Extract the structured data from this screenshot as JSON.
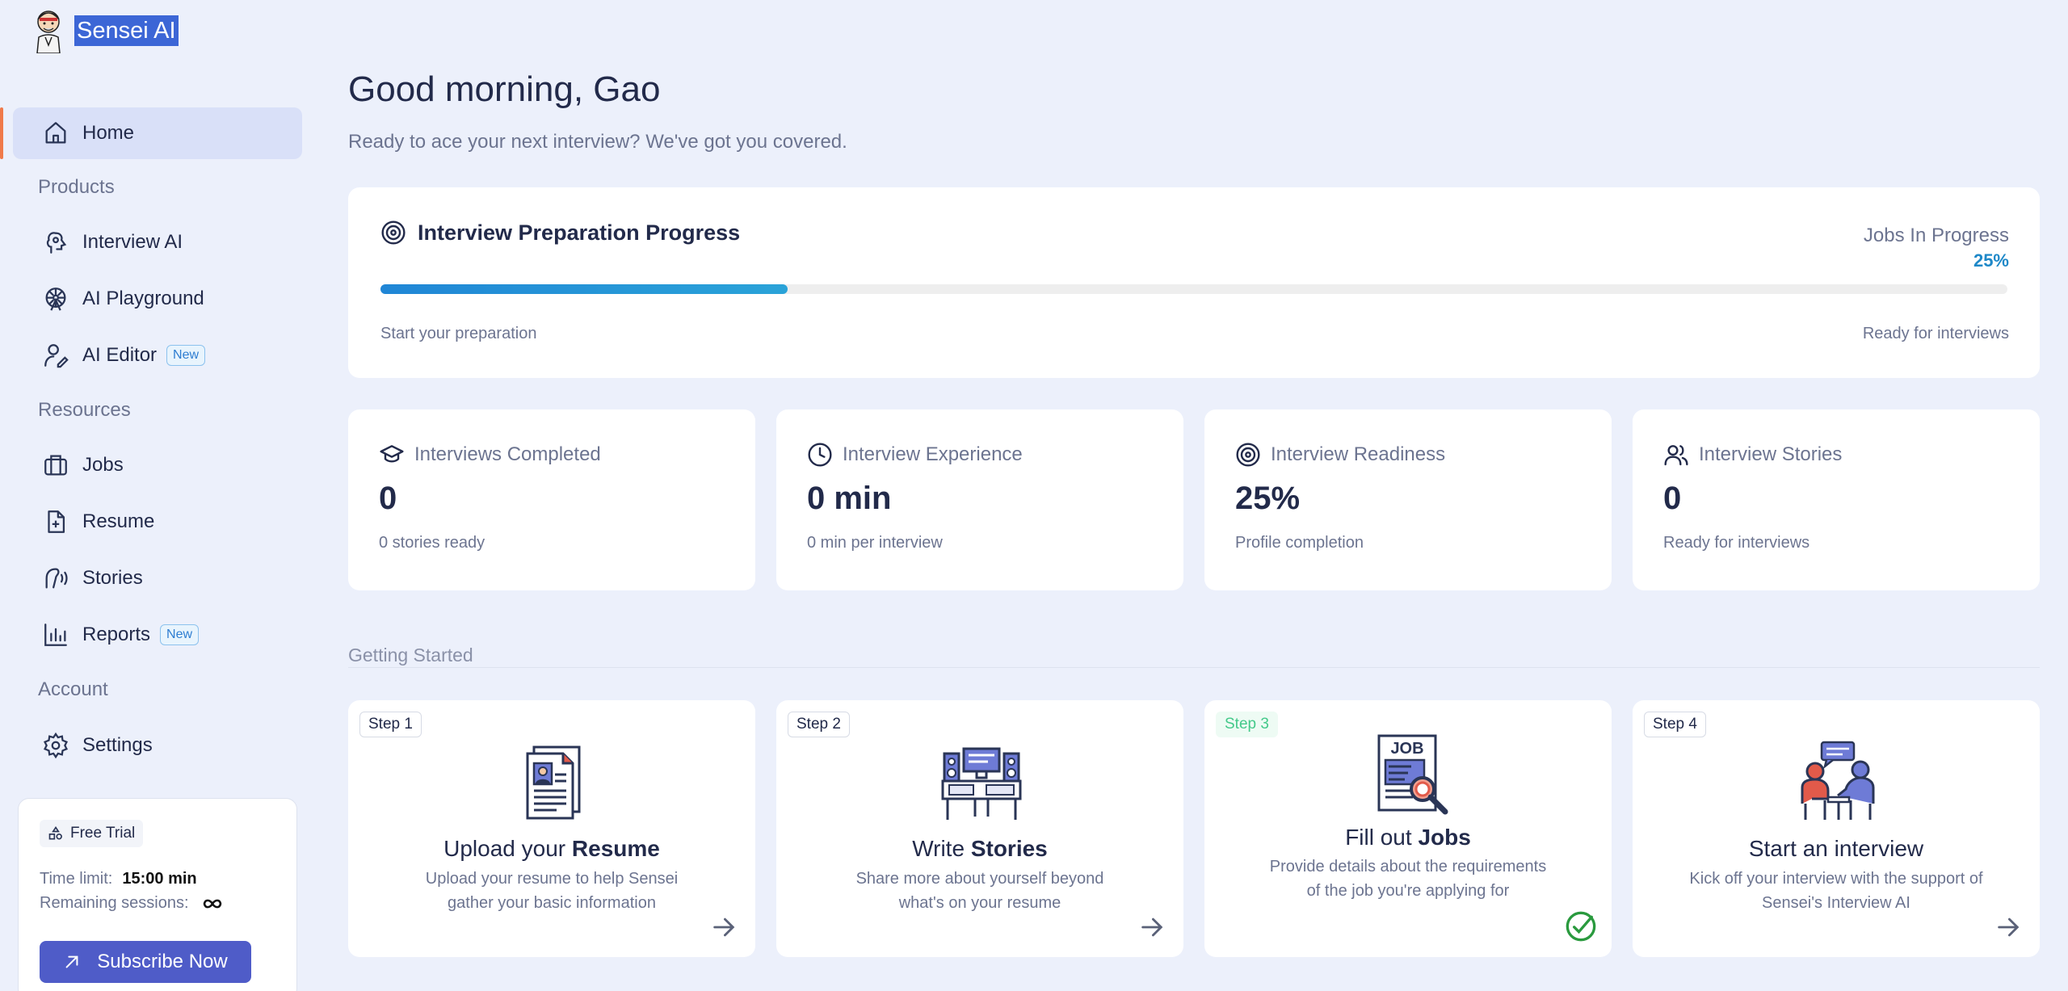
{
  "brand": {
    "name": "Sensei AI"
  },
  "sidebar": {
    "home": "Home",
    "products_label": "Products",
    "interview_ai": "Interview AI",
    "ai_playground": "AI Playground",
    "ai_editor": "AI Editor",
    "new_badge": "New",
    "resources_label": "Resources",
    "jobs": "Jobs",
    "resume": "Resume",
    "stories": "Stories",
    "reports": "Reports",
    "account_label": "Account",
    "settings": "Settings"
  },
  "trial": {
    "badge": "Free Trial",
    "time_limit_label": "Time limit:",
    "time_limit_value": "15:00 min",
    "remaining_label": "Remaining sessions:",
    "remaining_icon": "infinity-icon",
    "subscribe": "Subscribe Now"
  },
  "header": {
    "greeting": "Good morning, Gao",
    "subtitle": "Ready to ace your next interview? We've got you covered."
  },
  "progress": {
    "title": "Interview Preparation Progress",
    "jobs_label": "Jobs In Progress",
    "percent_text": "25%",
    "percent_value": 25,
    "start_label": "Start your preparation",
    "end_label": "Ready for interviews"
  },
  "stats": [
    {
      "label": "Interviews Completed",
      "value": "0",
      "sub": "0 stories ready"
    },
    {
      "label": "Interview Experience",
      "value": "0 min",
      "sub": "0 min per interview"
    },
    {
      "label": "Interview Readiness",
      "value": "25%",
      "sub": "Profile completion"
    },
    {
      "label": "Interview Stories",
      "value": "0",
      "sub": "Ready for interviews"
    }
  ],
  "getting_started": {
    "label": "Getting Started",
    "steps": [
      {
        "badge": "Step 1",
        "title_pre": "Upload your ",
        "title_bold": "Resume",
        "desc": "Upload your resume to help Sensei gather your basic information"
      },
      {
        "badge": "Step 2",
        "title_pre": "Write ",
        "title_bold": "Stories",
        "desc": "Share more about yourself beyond what's on your resume"
      },
      {
        "badge": "Step 3",
        "title_pre": "Fill out ",
        "title_bold": "Jobs",
        "desc": "Provide details about the requirements of the job you're applying for"
      },
      {
        "badge": "Step 4",
        "title_pre": "Start an interview",
        "title_bold": "",
        "desc": "Kick off your interview with the support of Sensei's Interview AI"
      }
    ]
  },
  "colors": {
    "accent": "#4f5cc8",
    "progress": "#2086d6",
    "success": "#2a9a3e",
    "active_bar": "#f07a4a"
  }
}
